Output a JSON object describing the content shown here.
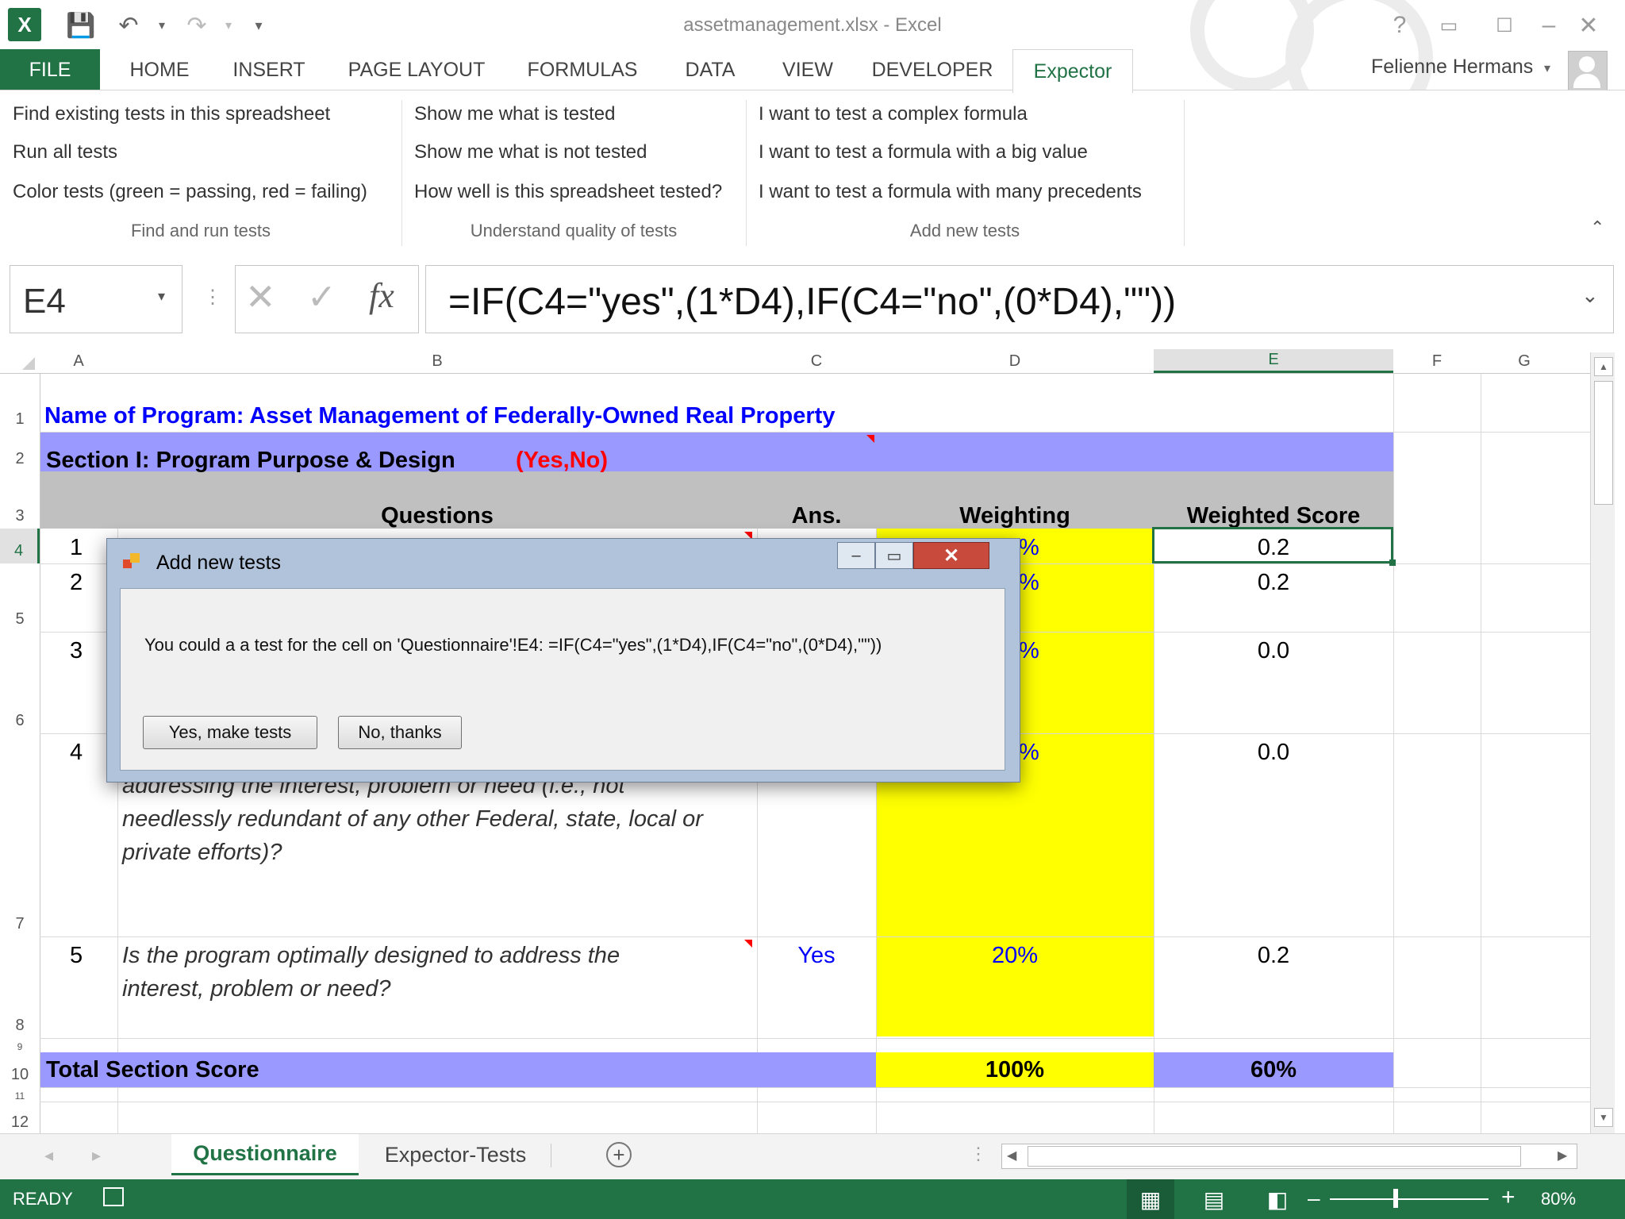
{
  "window": {
    "title": "assetmanagement.xlsx - Excel",
    "user": "Felienne Hermans",
    "help": "?"
  },
  "ribbon_tabs": [
    "FILE",
    "HOME",
    "INSERT",
    "PAGE LAYOUT",
    "FORMULAS",
    "DATA",
    "VIEW",
    "DEVELOPER",
    "Expector"
  ],
  "ribbon": {
    "groups": [
      {
        "name": "Find and run tests",
        "items": [
          "Find existing tests in this spreadsheet",
          "Run all tests",
          "Color tests (green = passing, red = failing)"
        ]
      },
      {
        "name": "Understand quality of tests",
        "items": [
          "Show me what is tested",
          "Show me what is not tested",
          "How well is this spreadsheet tested?"
        ]
      },
      {
        "name": "Add new tests",
        "items": [
          "I want to test a complex formula",
          "I want to test a formula with a big value",
          "I want to test a formula with many precedents"
        ]
      }
    ]
  },
  "formula_bar": {
    "name_box": "E4",
    "fx": "fx",
    "formula": "=IF(C4=\"yes\",(1*D4),IF(C4=\"no\",(0*D4),\"\"))"
  },
  "columns": [
    "A",
    "B",
    "C",
    "D",
    "E",
    "F",
    "G"
  ],
  "rows": [
    "1",
    "2",
    "3",
    "4",
    "5",
    "6",
    "7",
    "8",
    "9",
    "10",
    "11",
    "12"
  ],
  "sheet": {
    "program_label": "Name of Program:  Asset Management of Federally-Owned Real Property",
    "section_label": "Section I:  Program Purpose & Design",
    "section_note": "(Yes,No)",
    "headers": {
      "questions": "Questions",
      "ans": "Ans.",
      "weighting": "Weighting",
      "weighted_score": "Weighted Score"
    },
    "rows": [
      {
        "num": "1",
        "weight_tail": "%",
        "score": "0.2"
      },
      {
        "num": "2",
        "weight_tail": "%",
        "score": "0.2"
      },
      {
        "num": "3",
        "weight_tail": "%",
        "score": "0.0"
      },
      {
        "num": "4",
        "weight_tail": "%",
        "score": "0.0",
        "question_lines": [
          "addressing the interest, problem or need (i.e., not",
          "needlessly redundant of any other Federal, state, local or",
          "private efforts)?"
        ]
      },
      {
        "num": "5",
        "question_lines": [
          "Is the program optimally designed to address the",
          "interest, problem or need?"
        ],
        "ans": "Yes",
        "weight": "20%",
        "score": "0.2"
      }
    ],
    "total_label": "Total Section Score",
    "total_weight": "100%",
    "total_score": "60%"
  },
  "dialog": {
    "title": "Add new tests",
    "message": "You could a a test for the cell on 'Questionnaire'!E4: =IF(C4=\"yes\",(1*D4),IF(C4=\"no\",(0*D4),\"\"))",
    "yes_button": "Yes, make tests",
    "no_button": "No, thanks"
  },
  "sheet_tabs": [
    "Questionnaire",
    "Expector-Tests"
  ],
  "status": {
    "ready": "READY",
    "zoom": "80%"
  },
  "colors": {
    "excel_green": "#217346",
    "band_blue": "#9999ff",
    "yellow": "#ffff00",
    "title_blue": "#0000ff",
    "red": "#ff0000",
    "gray_band": "#c0c0c0"
  }
}
